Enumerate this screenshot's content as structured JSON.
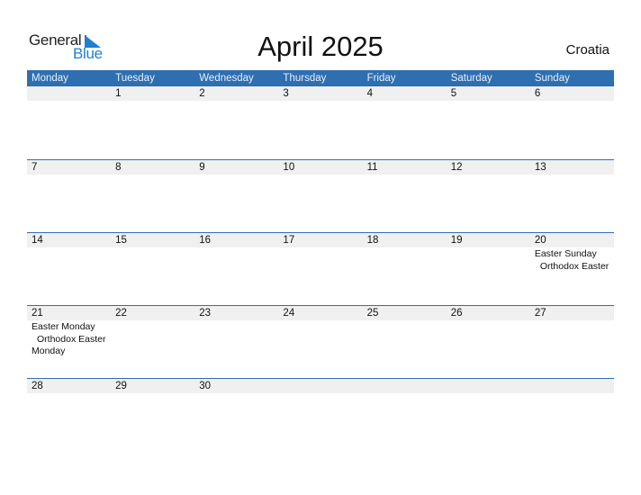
{
  "logo": {
    "line1": "General",
    "line2": "Blue"
  },
  "title": "April 2025",
  "country": "Croatia",
  "weekdays": [
    "Monday",
    "Tuesday",
    "Wednesday",
    "Thursday",
    "Friday",
    "Saturday",
    "Sunday"
  ],
  "weeks": [
    {
      "days": [
        "",
        "1",
        "2",
        "3",
        "4",
        "5",
        "6"
      ],
      "events": [
        [],
        [],
        [],
        [],
        [],
        [],
        []
      ]
    },
    {
      "days": [
        "7",
        "8",
        "9",
        "10",
        "11",
        "12",
        "13"
      ],
      "events": [
        [],
        [],
        [],
        [],
        [],
        [],
        []
      ]
    },
    {
      "days": [
        "14",
        "15",
        "16",
        "17",
        "18",
        "19",
        "20"
      ],
      "events": [
        [],
        [],
        [],
        [],
        [],
        [],
        [
          "Easter Sunday",
          " Orthodox Easter"
        ]
      ]
    },
    {
      "days": [
        "21",
        "22",
        "23",
        "24",
        "25",
        "26",
        "27"
      ],
      "events": [
        [
          "Easter Monday",
          " Orthodox Easter",
          "Monday"
        ],
        [],
        [],
        [],
        [],
        [],
        []
      ]
    },
    {
      "days": [
        "28",
        "29",
        "30",
        "",
        "",
        "",
        ""
      ],
      "events": [
        [],
        [],
        [],
        [],
        [],
        [],
        []
      ]
    }
  ],
  "colors": {
    "header": "#2e6fb1",
    "strip": "#f0f0f0",
    "brand": "#1f7fd1"
  }
}
